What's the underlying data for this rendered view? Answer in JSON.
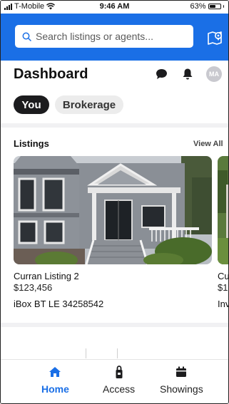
{
  "status_bar": {
    "carrier": "T-Mobile",
    "time": "9:46 AM",
    "battery": "63%",
    "battery_level": 0.63
  },
  "header": {
    "search_placeholder": "Search listings or agents...",
    "search_icon": "search-icon",
    "map_icon": "map-pin-icon",
    "accent_color": "#1a6fe6"
  },
  "dashboard": {
    "title": "Dashboard",
    "chat_icon": "chat-bubble-icon",
    "bell_icon": "bell-icon",
    "avatar_initials": "MA"
  },
  "scope_toggle": {
    "options": [
      {
        "label": "You",
        "selected": true
      },
      {
        "label": "Brokerage",
        "selected": false
      }
    ]
  },
  "listings": {
    "section_title": "Listings",
    "view_all_label": "View All",
    "cards": [
      {
        "name": "Curran Listing 2",
        "price": "$123,456",
        "lockbox": "iBox BT LE 34258542"
      },
      {
        "name": "Cu",
        "price": "$12",
        "lockbox": "Inv"
      }
    ]
  },
  "bottom_nav": {
    "items": [
      {
        "label": "Home",
        "icon": "home-icon",
        "active": true
      },
      {
        "label": "Access",
        "icon": "lockbox-icon",
        "active": false
      },
      {
        "label": "Showings",
        "icon": "calendar-icon",
        "active": false
      }
    ]
  }
}
